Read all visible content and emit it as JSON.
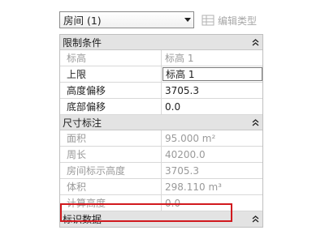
{
  "top_bar": {
    "type_selector_value": "房间 (1)",
    "edit_type_label": "编辑类型"
  },
  "sections": {
    "constraints": {
      "title": "限制条件",
      "rows": [
        {
          "name": "标高",
          "value": "标高 1"
        },
        {
          "name": "上限",
          "value": "标高 1"
        },
        {
          "name": "高度偏移",
          "value": "3705.3"
        },
        {
          "name": "底部偏移",
          "value": "0.0"
        }
      ]
    },
    "dimensions": {
      "title": "尺寸标注",
      "rows": [
        {
          "name": "面积",
          "value": "95.000 m²"
        },
        {
          "name": "周长",
          "value": "40200.0"
        },
        {
          "name": "房间标示高度",
          "value": "3705.3"
        },
        {
          "name": "体积",
          "value": "298.110 m³"
        },
        {
          "name": "计算高度",
          "value": "0.0"
        }
      ]
    },
    "identity": {
      "title": "标识数据"
    }
  },
  "colors": {
    "highlight_border": "#d1191e",
    "section_header_bg": "#e3e3e3",
    "readonly_text": "#9a9a9a"
  }
}
